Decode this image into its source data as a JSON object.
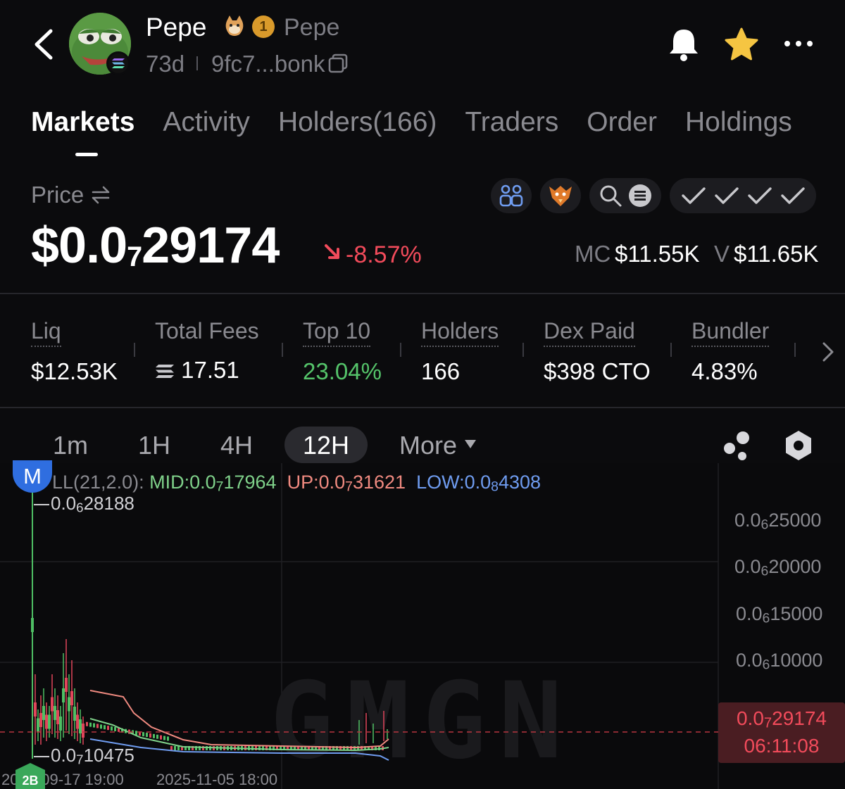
{
  "header": {
    "token_name": "Pepe",
    "token_alias": "Pepe",
    "rank_badge": "1",
    "age": "73d",
    "address": "9fc7...bonk",
    "icons": [
      "back-arrow-icon",
      "bell-icon",
      "star-icon",
      "more-dots-icon",
      "copy-icon",
      "solana-icon",
      "doge-icon"
    ],
    "colors": {
      "star": "#f5c542",
      "accent_down": "#f24b5b",
      "accent_up": "#55c46a"
    }
  },
  "tabs": [
    {
      "label": "Markets",
      "active": true
    },
    {
      "label": "Activity",
      "active": false
    },
    {
      "label": "Holders(166)",
      "active": false
    },
    {
      "label": "Traders",
      "active": false
    },
    {
      "label": "Order",
      "active": false
    },
    {
      "label": "Holdings",
      "active": false
    }
  ],
  "price": {
    "label": "Price",
    "main_prefix": "$0.0",
    "main_sub": "7",
    "main_suffix": "29174",
    "change": "-8.57%",
    "mc_label": "MC",
    "mc_value": "$11.55K",
    "v_label": "V",
    "v_value": "$11.65K"
  },
  "stats": [
    {
      "label": "Liq",
      "value": "$12.53K"
    },
    {
      "label": "Total Fees",
      "value": "17.51"
    },
    {
      "label": "Top 10",
      "value": "23.04%"
    },
    {
      "label": "Holders",
      "value": "166"
    },
    {
      "label": "Dex Paid",
      "value": "$398 CTO"
    },
    {
      "label": "Bundler",
      "value": "4.83%"
    }
  ],
  "timeframes": {
    "items": [
      "1m",
      "1H",
      "4H",
      "12H"
    ],
    "active": "12H",
    "more_label": "More"
  },
  "chart": {
    "m_badge": "M",
    "legend_prefix": "LL(21,2.0):",
    "mid_label": "MID:0.0",
    "mid_sub": "7",
    "mid_val": "17964",
    "up_label": "UP:0.0",
    "up_sub": "7",
    "up_val": "31621",
    "low_label": "LOW:0.0",
    "low_sub": "8",
    "low_val": "4308",
    "high_ann_prefix": "0.0",
    "high_ann_sub": "6",
    "high_ann_val": "28188",
    "low_ann_prefix": "0.0",
    "low_ann_sub": "7",
    "low_ann_val": "10475",
    "watermark": "GMGN",
    "y_ticks": [
      {
        "pre": "0.0",
        "sub": "6",
        "val": "25000"
      },
      {
        "pre": "0.0",
        "sub": "6",
        "val": "20000"
      },
      {
        "pre": "0.0",
        "sub": "6",
        "val": "15000"
      },
      {
        "pre": "0.0",
        "sub": "6",
        "val": "10000"
      }
    ],
    "current_price_pre": "0.0",
    "current_price_sub": "7",
    "current_price_val": "29174",
    "current_time": "06:11:08",
    "x_labels": [
      "2025-09-17 19:00",
      "2025-11-05 18:00"
    ],
    "colors": {
      "mid": "#7fd18a",
      "up": "#f08a80",
      "low": "#6f9cf0",
      "candle_up": "#4fbf64",
      "candle_down": "#e0455a"
    }
  }
}
